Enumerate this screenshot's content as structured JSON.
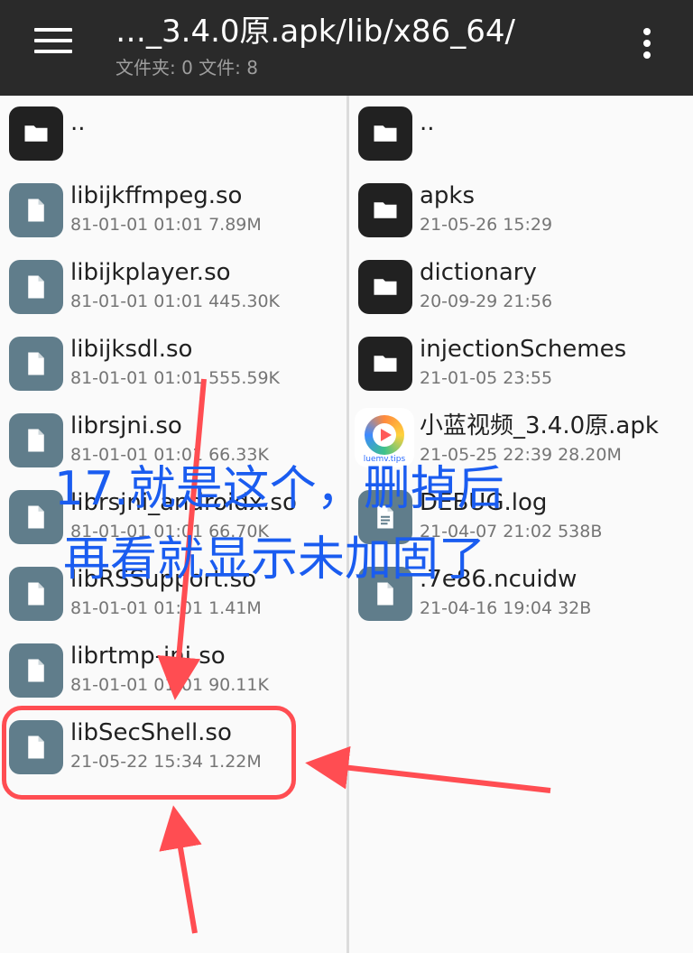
{
  "header": {
    "path_title": "…_3.4.0原.apk/lib/x86_64/",
    "counts": "文件夹: 0  文件: 8",
    "menu_icon": "hamburger-menu-icon",
    "overflow_icon": "more-vert-icon"
  },
  "left_pane": {
    "items": [
      {
        "name": "..",
        "meta": "",
        "type": "folder"
      },
      {
        "name": "libijkffmpeg.so",
        "meta": "81-01-01 01:01  7.89M",
        "type": "file"
      },
      {
        "name": "libijkplayer.so",
        "meta": "81-01-01 01:01  445.30K",
        "type": "file"
      },
      {
        "name": "libijksdl.so",
        "meta": "81-01-01 01:01  555.59K",
        "type": "file"
      },
      {
        "name": "librsjni.so",
        "meta": "81-01-01 01:01  66.33K",
        "type": "file"
      },
      {
        "name": "librsjni_androidx.so",
        "meta": "81-01-01 01:01  66.70K",
        "type": "file"
      },
      {
        "name": "libRSSupport.so",
        "meta": "81-01-01 01:01  1.41M",
        "type": "file"
      },
      {
        "name": "librtmp-jni.so",
        "meta": "81-01-01 01:01  90.11K",
        "type": "file"
      },
      {
        "name": "libSecShell.so",
        "meta": "21-05-22 15:34  1.22M",
        "type": "file"
      }
    ]
  },
  "right_pane": {
    "items": [
      {
        "name": "..",
        "meta": "",
        "type": "folder"
      },
      {
        "name": "apks",
        "meta": "21-05-26 15:29",
        "type": "folder"
      },
      {
        "name": "dictionary",
        "meta": "20-09-29 21:56",
        "type": "folder"
      },
      {
        "name": "injectionSchemes",
        "meta": "21-01-05 23:55",
        "type": "folder"
      },
      {
        "name": "小蓝视频_3.4.0原.apk",
        "meta": "21-05-25 22:39  28.20M",
        "type": "apk",
        "icon_label": "luemv.tips"
      },
      {
        "name": "DEBUG.log",
        "meta": "21-04-07 21:02  538B",
        "type": "doc"
      },
      {
        "name": ".7e86.ncuidw",
        "meta": "21-04-16 19:04  32B",
        "type": "file"
      }
    ]
  },
  "annotation": {
    "line1": "17.就是这个，删掉后",
    "line2": "再看就显示未加固了",
    "color": "#1a5cf0",
    "arrow_color": "#ff4d52"
  }
}
